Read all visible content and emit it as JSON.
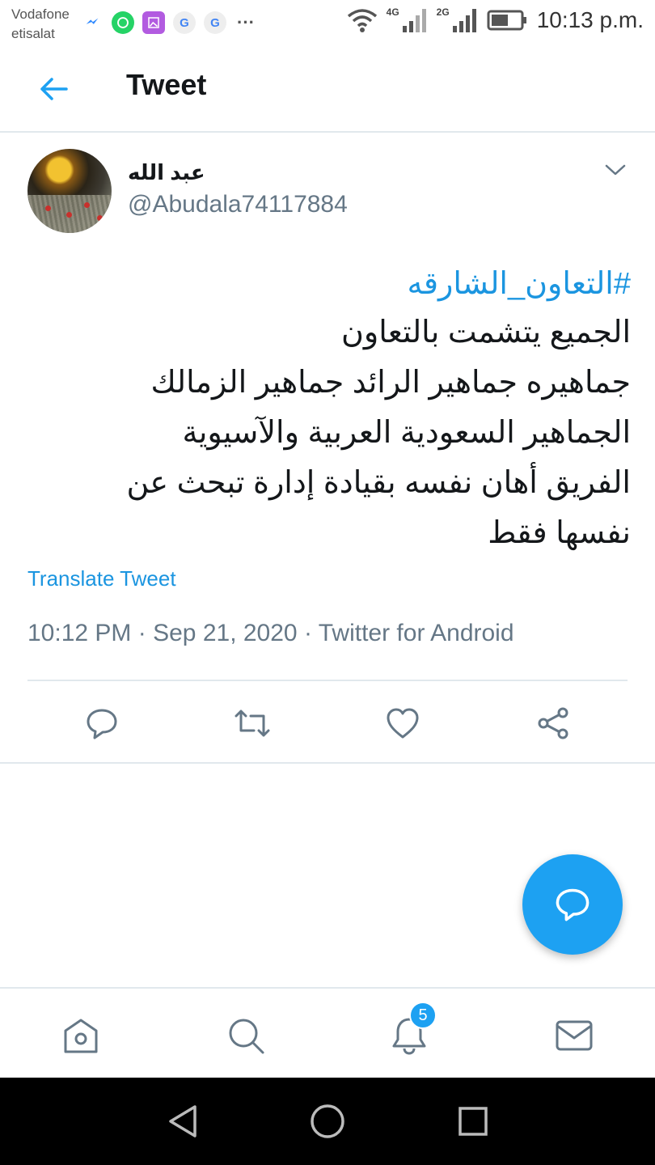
{
  "status_bar": {
    "carrier_line1": "Vodafone",
    "carrier_line2": "etisalat",
    "net1": "4G",
    "net2": "2G",
    "time": "10:13 p.m.",
    "notification_icons": [
      "messenger-icon",
      "whatsapp-icon",
      "gallery-icon",
      "google-icon",
      "google-icon",
      "more-icon"
    ]
  },
  "header": {
    "title": "Tweet"
  },
  "tweet": {
    "display_name": "عبد الله",
    "handle": "@Abudala74117884",
    "hashtag": "#التعاون_الشارقه",
    "lines": [
      "الجميع يتشمت بالتعاون",
      "جماهيره جماهير الرائد جماهير الزمالك",
      "الجماهير السعودية العربية والآسيوية",
      "الفريق أهان نفسه بقيادة إدارة تبحث عن",
      "نفسها فقط"
    ],
    "translate_label": "Translate Tweet",
    "time": "10:12 PM",
    "separator": "·",
    "date": "Sep 21, 2020",
    "source": "Twitter for Android"
  },
  "actions": [
    "reply-icon",
    "retweet-icon",
    "like-icon",
    "share-icon"
  ],
  "bottom_nav": {
    "items": [
      "home-icon",
      "search-icon",
      "notifications-icon",
      "messages-icon"
    ],
    "notification_badge": "5"
  },
  "colors": {
    "accent": "#1da1f2",
    "link": "#1b95e0",
    "secondary_text": "#657786",
    "divider": "#e1e8ed"
  }
}
